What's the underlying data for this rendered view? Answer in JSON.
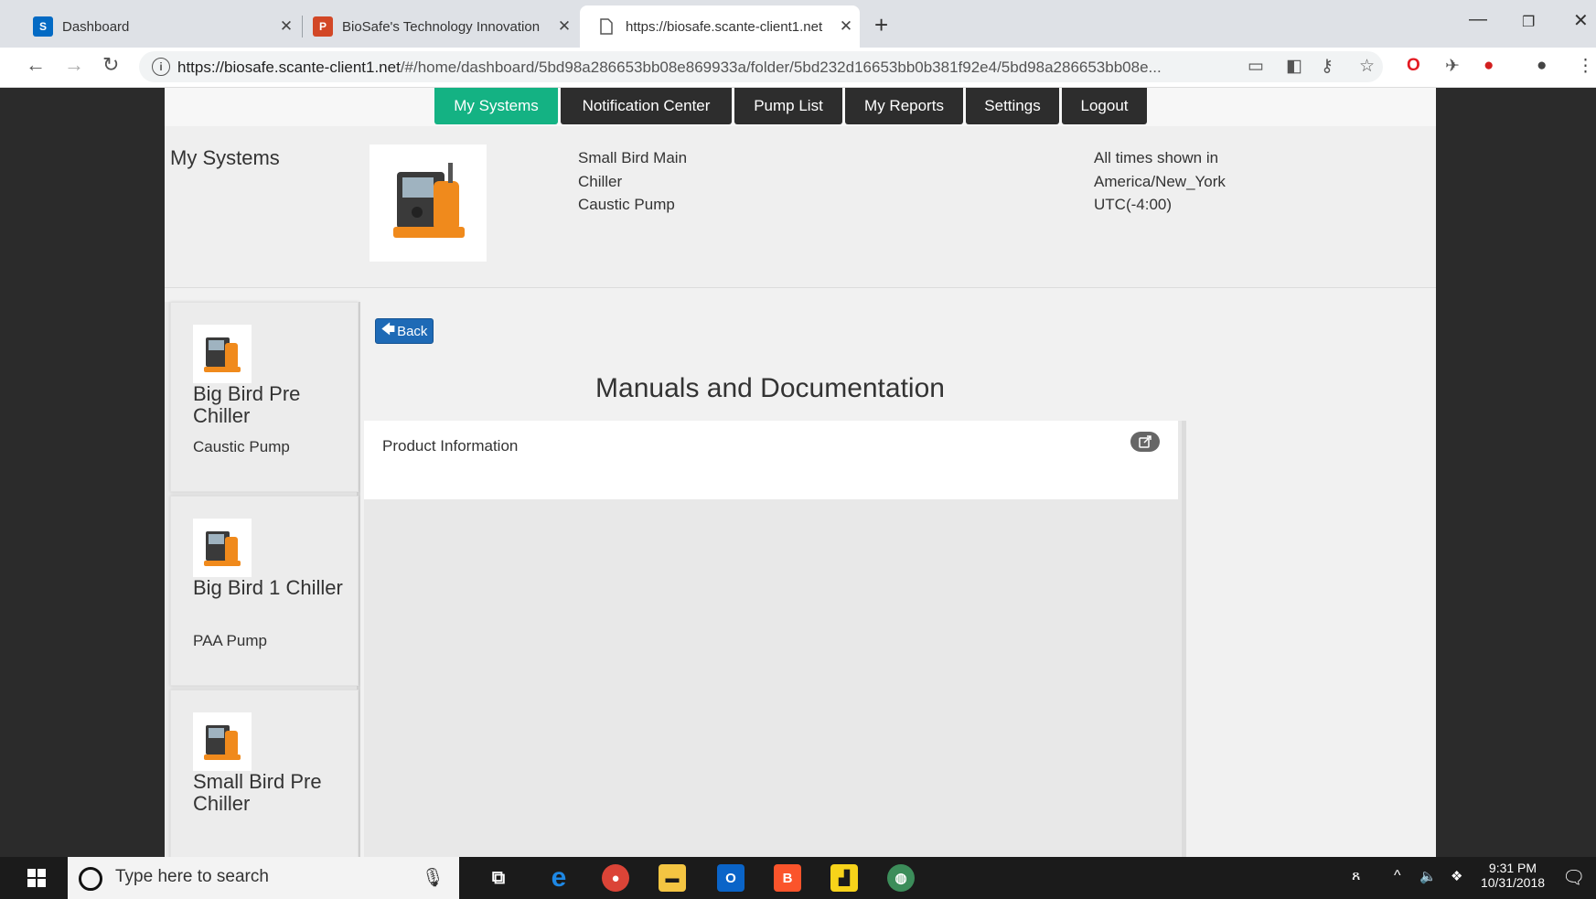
{
  "browser": {
    "tabs": [
      {
        "title": "Dashboard",
        "icon": "sharepoint-icon",
        "color": "#036ac4"
      },
      {
        "title": "BioSafe's Technology Innovation",
        "icon": "powerpoint-icon",
        "color": "#d24726"
      },
      {
        "title": "https://biosafe.scante-client1.net",
        "icon": "page-icon",
        "color": "#ffffff"
      }
    ],
    "url_host": "https://biosafe.scante-client1.net",
    "url_path": "/#/home/dashboard/5bd98a286653bb08e869933a/folder/5bd232d16653bb0b381f92e4/5bd98a286653bb08e..."
  },
  "nav": {
    "items": [
      "My Systems",
      "Notification Center",
      "Pump List",
      "My Reports",
      "Settings",
      "Logout"
    ],
    "active_color": "#14b283"
  },
  "header": {
    "title": "My Systems",
    "system_lines": [
      "Small Bird Main",
      "Chiller",
      "Caustic Pump"
    ],
    "timezone_lines": [
      "All times shown in",
      "America/New_York",
      "UTC(-4:00)"
    ]
  },
  "sidebar": {
    "cards": [
      {
        "name": "Big Bird Pre Chiller",
        "type": "Caustic Pump"
      },
      {
        "name": "Big Bird 1 Chiller",
        "type": "PAA Pump"
      },
      {
        "name": "Small Bird Pre Chiller",
        "type": ""
      }
    ]
  },
  "main": {
    "back_label": "Back",
    "section_title": "Manuals and Documentation",
    "documents": [
      {
        "label": "Product Information"
      }
    ]
  },
  "taskbar": {
    "search_placeholder": "Type here to search",
    "time": "9:31 PM",
    "date": "10/31/2018"
  }
}
